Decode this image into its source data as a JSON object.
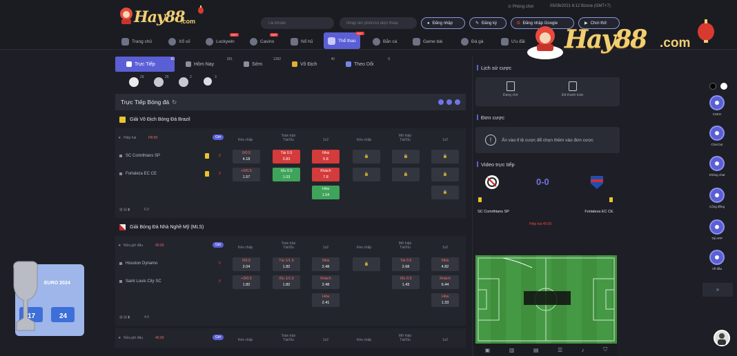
{
  "topbar": {
    "logo_text": "Hay88",
    "logo_suffix": ".com",
    "search_placeholder": "Tài khoản",
    "search2_placeholder": "Nhập tên phim/số điện thoại",
    "clock": "Phòng chơi",
    "datetime": "05/08/2021 6:12 Bzone (GMT+7)",
    "login_label": "Đăng nhập",
    "register_label": "Đăng ký",
    "google_label": "Đăng nhập Google",
    "demo_label": "Chơi thử"
  },
  "nav": {
    "items": [
      {
        "label": "Trang chủ",
        "icon": "home-icon"
      },
      {
        "label": "Xổ số",
        "icon": "lottery-icon"
      },
      {
        "label": "Luckywin",
        "icon": "luckywin-icon",
        "hot": "HOT"
      },
      {
        "label": "Casino",
        "icon": "casino-icon",
        "hot": "HOT"
      },
      {
        "label": "Nổ hũ",
        "icon": "slot-icon"
      },
      {
        "label": "Thể thao",
        "icon": "sport-icon",
        "hot": "HOT",
        "active": true
      },
      {
        "label": "Bắn cá",
        "icon": "fish-icon"
      },
      {
        "label": "Game bài",
        "icon": "cards-icon"
      },
      {
        "label": "Đá gà",
        "icon": "rooster-icon"
      },
      {
        "label": "Ưu đãi",
        "icon": "gift-icon"
      }
    ]
  },
  "tabs": [
    {
      "label": "Trực Tiếp",
      "count": "60",
      "active": true
    },
    {
      "label": "Hôm Nay",
      "count": "281"
    },
    {
      "label": "Sớm",
      "count": "1282"
    },
    {
      "label": "Vô Địch",
      "count": "40"
    },
    {
      "label": "Theo Dõi",
      "count": "0"
    }
  ],
  "sports": [
    {
      "icon": "soccer-icon",
      "count": "29"
    },
    {
      "icon": "basketball-icon",
      "count": "25"
    },
    {
      "icon": "volleyball-icon",
      "count": "2"
    },
    {
      "icon": "tennis-icon",
      "count": "3"
    }
  ],
  "section": {
    "title": "Trực Tiếp Bóng đá"
  },
  "leagues": [
    {
      "name": "Giải Vô Địch Bóng Đá Brazil",
      "status": "Hiệp hai",
      "time": "FB:00",
      "badge": "Giờ",
      "cols": [
        "Kèo chấp",
        "Toàn trận Tài/Xỉu",
        "1x2",
        "Kèo chấp",
        "Mở hiệp Tài/Xỉu",
        "1x2"
      ],
      "matches": [
        {
          "team": "SC Corinthians SP",
          "score": "0",
          "odds": [
            [
              "0/0.5",
              "4.18"
            ],
            [
              "Tài 0.5",
              "3.83"
            ],
            [
              "Nhà",
              "5.8"
            ]
          ]
        },
        {
          "team": "Fortaleza EC CE",
          "score": "0",
          "odds": [
            [
              "+0/0.5",
              "1.57"
            ],
            [
              "Xỉu 0.5",
              "1.03"
            ],
            [
              "Khách",
              "7.8"
            ]
          ]
        }
      ],
      "draw": [
        "Hòa",
        "1.54"
      ],
      "footer": "6.0"
    },
    {
      "name": "Giải Bóng Đá Nhà Nghề Mỹ (MLS)",
      "status": "Nửa giờ đầu",
      "time": "45:00",
      "badge": "Giờ",
      "cols": [
        "Kèo chấp",
        "Toàn trận Tài/Xỉu",
        "1x2",
        "Kèo chấp",
        "Mở hiệp Tài/Xỉu",
        "1x2"
      ],
      "matches": [
        {
          "team": "Houston Dynamo",
          "score": "0",
          "odds": [
            [
              "0/0.5",
              "2.04"
            ],
            [
              "Tài 1/1.5",
              "1.82"
            ],
            [
              "Nhà",
              "2.48"
            ]
          ],
          "odds2": [
            [
              "Tài 0.5",
              "2.68"
            ],
            [
              "Nhà",
              "4.82"
            ]
          ]
        },
        {
          "team": "Saint Louis City SC",
          "score": "0",
          "odds": [
            [
              "+0/0.5",
              "1.82"
            ],
            [
              "Xỉu 1/1.5",
              "1.82"
            ],
            [
              "Khách",
              "2.48"
            ]
          ],
          "odds2": [
            [
              "Xỉu 0.5",
              "1.43"
            ],
            [
              "Khách",
              "6.44"
            ]
          ]
        }
      ],
      "draw": [
        "Hòa",
        "2.41"
      ],
      "draw2": [
        "Hòa",
        "1.33"
      ],
      "footer": "4.0"
    },
    {
      "status": "Nửa giờ đầu",
      "time": "45:00",
      "badge": "Giờ",
      "cols": [
        "Kèo chấp",
        "Toàn trận Tài/Xỉu",
        "1x2",
        "Kèo chấp",
        "Mở hiệp Tài/Xỉu",
        "1x2"
      ]
    }
  ],
  "right": {
    "history_title": "Lịch sử cược",
    "history_btn1": "Đang chờ",
    "history_btn2": "Đã thanh toán",
    "slip_title": "Đơn cược",
    "slip_msg": "Ấn vào tỉ lệ cược để chọn thêm vào đơn cược",
    "video_title": "Video trực tiếp",
    "home": "SC Corinthians SP",
    "away": "Fortaleza EC CE",
    "score": "0-0",
    "period": "Hiệp hai 45:00",
    "toolbar_icons": [
      "stats-icon",
      "chart-icon",
      "lineup-icon",
      "table-icon",
      "mic-icon",
      "shirt-icon"
    ]
  },
  "deco": {
    "text": "Hay88",
    "suffix": ".com"
  },
  "rail": [
    {
      "label": "CSKH"
    },
    {
      "label": "Chat bot"
    },
    {
      "label": "Không chat"
    },
    {
      "label": "Cộng đồng"
    },
    {
      "label": "Tải APP"
    },
    {
      "label": "Về đầu"
    }
  ],
  "euro": {
    "title": "EURO 2024",
    "d1": "17",
    "d2": "24"
  }
}
